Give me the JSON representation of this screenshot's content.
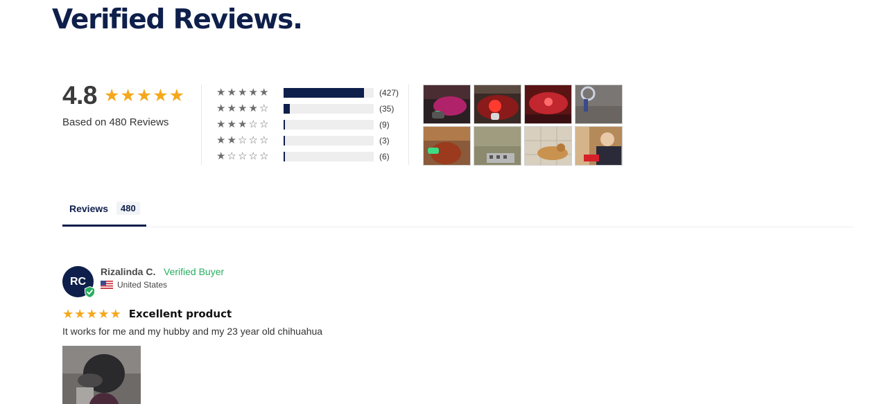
{
  "page": {
    "title": "Verified Reviews."
  },
  "summary": {
    "average": "4.8",
    "average_stars": 5,
    "based_on": "Based on 480 Reviews"
  },
  "histogram": [
    {
      "stars": 5,
      "count_label": "(427)",
      "fraction": 0.89
    },
    {
      "stars": 4,
      "count_label": "(35)",
      "fraction": 0.073
    },
    {
      "stars": 3,
      "count_label": "(9)",
      "fraction": 0.019
    },
    {
      "stars": 2,
      "count_label": "(3)",
      "fraction": 0.006
    },
    {
      "stars": 1,
      "count_label": "(6)",
      "fraction": 0.012
    }
  ],
  "media": {
    "thumbnail_count": 8
  },
  "tabs": [
    {
      "label": "Reviews",
      "count": "480",
      "active": true
    }
  ],
  "reviews": [
    {
      "initials": "RC",
      "name": "Rizalinda C.",
      "verified_label": "Verified Buyer",
      "country": "United States",
      "rating": 5,
      "title": "Excellent product",
      "body": "It works for me and my hubby and my 23 year old chihuahua"
    }
  ],
  "colors": {
    "brand_navy": "#0f1f4b",
    "star_gold": "#f5a81c",
    "verified_green": "#27ae60"
  }
}
